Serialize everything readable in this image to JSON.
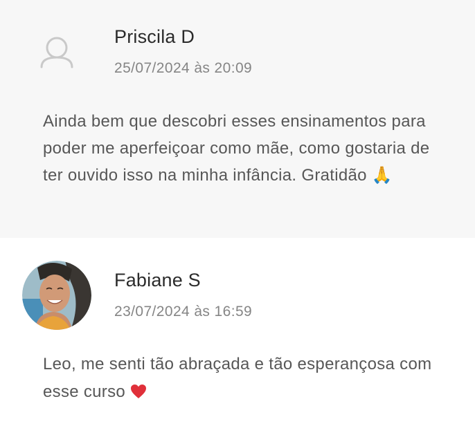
{
  "comments": [
    {
      "author": "Priscila D",
      "date": "25/07/2024 às 20:09",
      "text": "Ainda bem que descobri esses ensinamentos para poder me aperfeiçoar como mãe, como gostaria de ter ouvido isso na minha infância. Gratidão",
      "emoji": "🙏",
      "avatar_icon": "default-user-icon"
    },
    {
      "author": "Fabiane S",
      "date": "23/07/2024 às 16:59",
      "text": "Leo, me senti tão abraçada e tão esperançosa com esse curso",
      "emoji": "❤️",
      "avatar_icon": "profile-photo"
    }
  ],
  "colors": {
    "first_comment_bg": "#f7f7f7",
    "second_comment_bg": "#ffffff",
    "name": "#2b2b2b",
    "date": "#858585",
    "body": "#575757",
    "heart": "#e0303a"
  }
}
